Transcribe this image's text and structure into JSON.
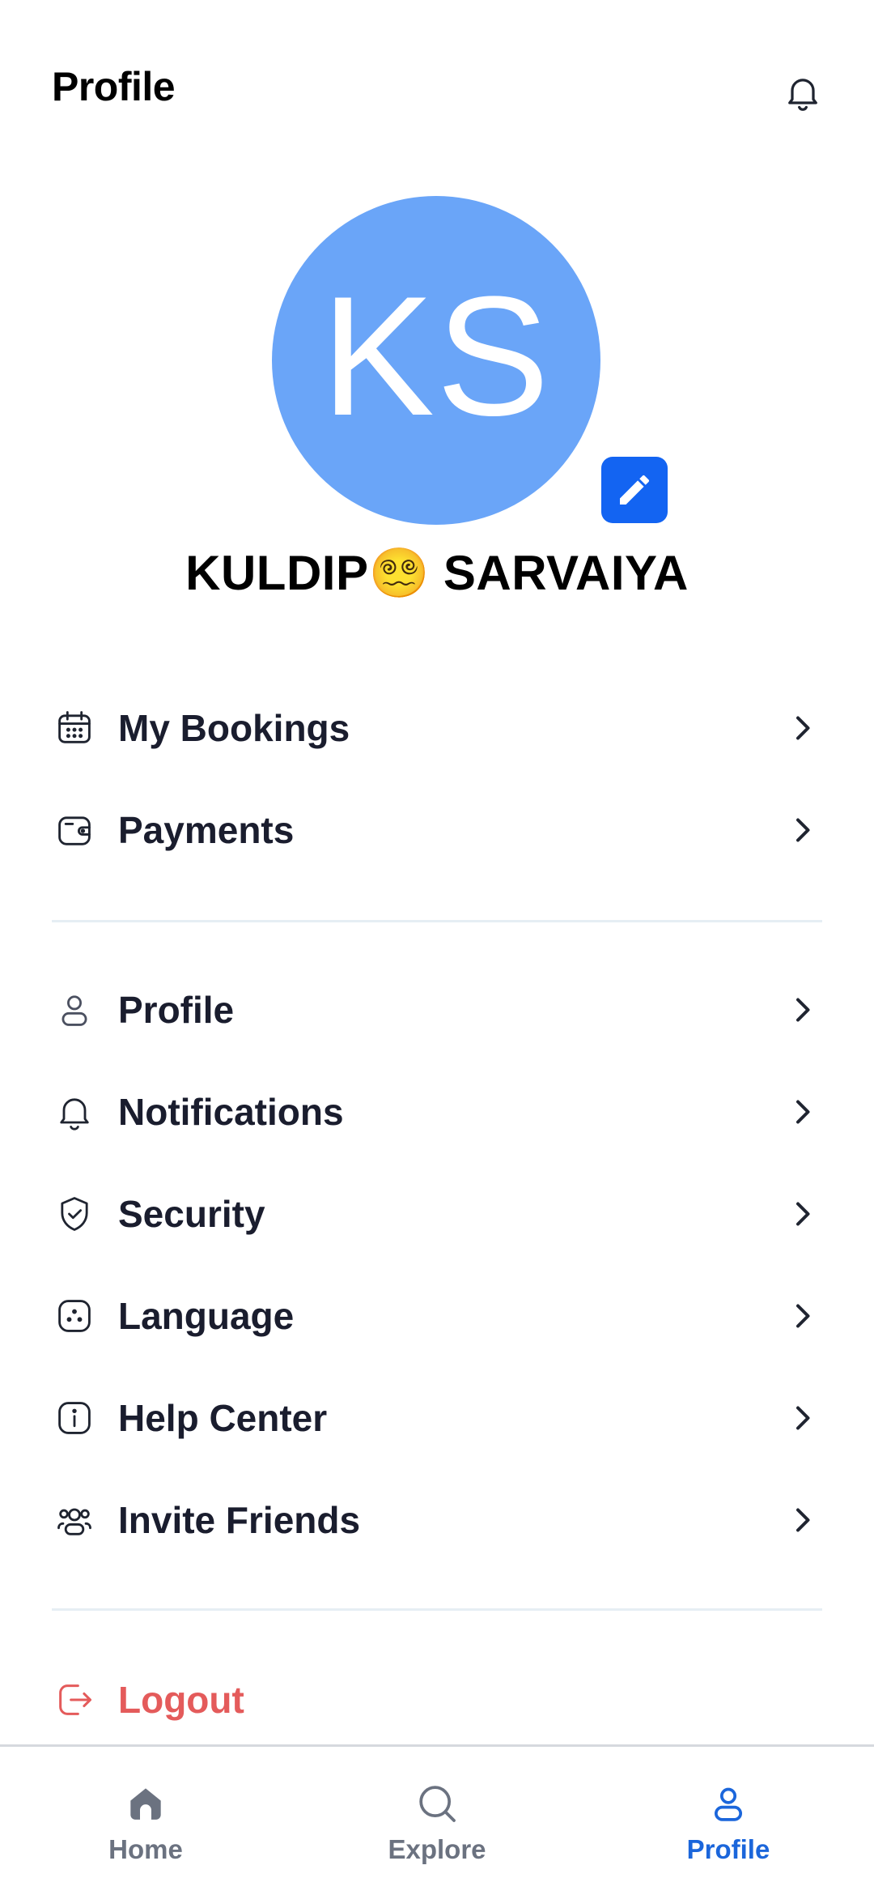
{
  "header": {
    "title": "Profile",
    "bell_icon": "bell-icon"
  },
  "user": {
    "initials": "KS",
    "name": "KULDIP😵‍💫 SARVAIYA",
    "avatar_color": "#6aa5f8",
    "edit_icon": "pencil-icon",
    "edit_button_color": "#1364f2"
  },
  "menu_group_1": [
    {
      "label": "My Bookings",
      "icon": "calendar-icon"
    },
    {
      "label": "Payments",
      "icon": "wallet-icon"
    }
  ],
  "menu_group_2": [
    {
      "label": "Profile",
      "icon": "user-icon"
    },
    {
      "label": "Notifications",
      "icon": "bell-icon"
    },
    {
      "label": "Security",
      "icon": "shield-check-icon"
    },
    {
      "label": "Language",
      "icon": "language-icon"
    },
    {
      "label": "Help Center",
      "icon": "info-icon"
    },
    {
      "label": "Invite Friends",
      "icon": "users-icon"
    }
  ],
  "logout": {
    "label": "Logout",
    "icon": "logout-icon",
    "color": "#e45b5b"
  },
  "bottom_nav": {
    "active": "Profile",
    "active_color": "#1b66db",
    "items": [
      {
        "label": "Home",
        "icon": "home-icon"
      },
      {
        "label": "Explore",
        "icon": "search-icon"
      },
      {
        "label": "Profile",
        "icon": "user-icon"
      }
    ]
  }
}
